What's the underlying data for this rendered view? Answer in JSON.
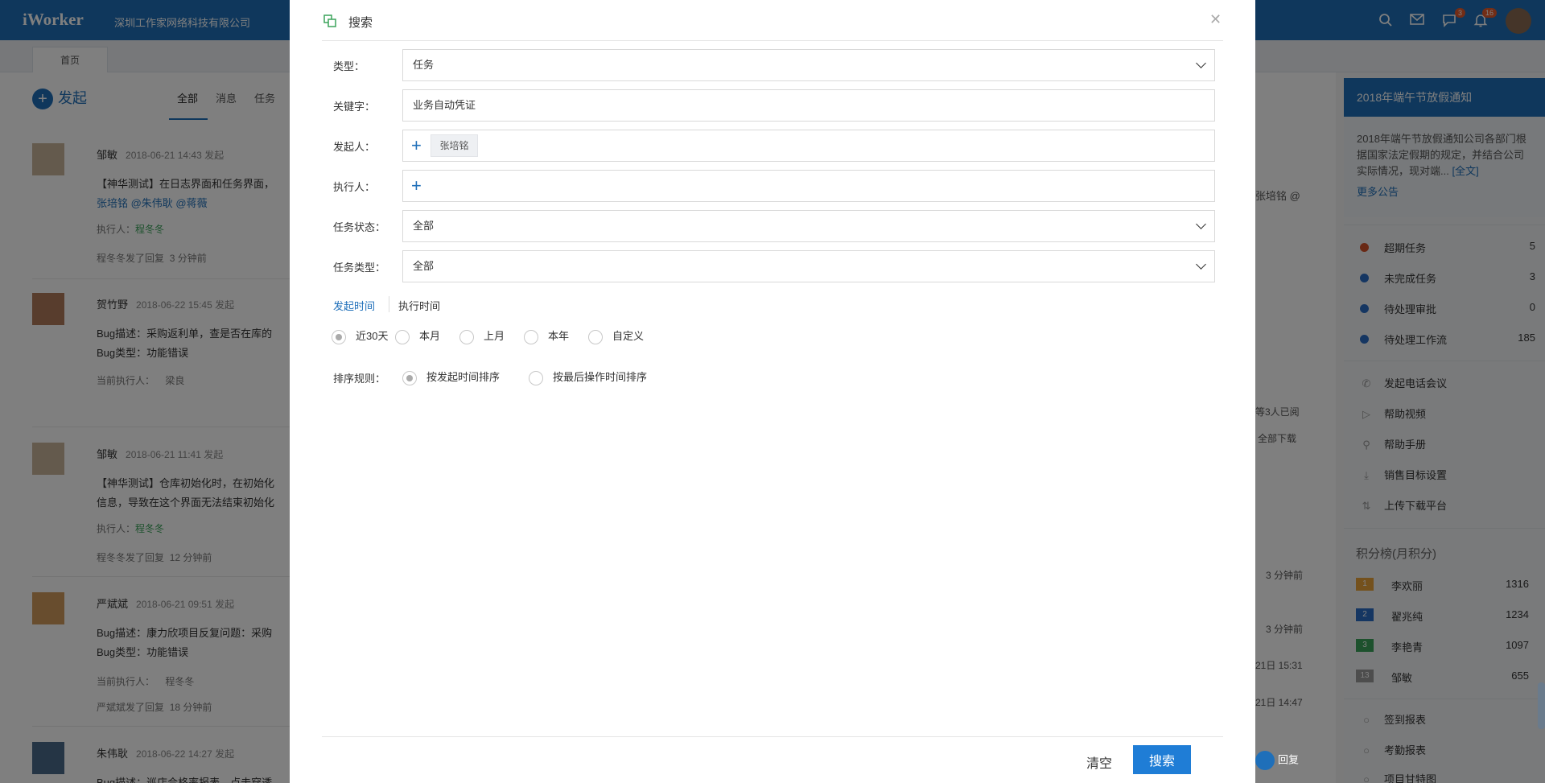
{
  "app": {
    "logo": "iWorker",
    "company": "深圳工作家网络科技有限公司",
    "badges": {
      "messages": "3",
      "notifications": "16"
    }
  },
  "tabs": {
    "home": "首页"
  },
  "feed": {
    "launch_label": "发起",
    "filters": [
      "全部",
      "消息",
      "任务"
    ],
    "items": [
      {
        "name": "邹敏",
        "time": "2018-06-21 14:43 发起",
        "line1": "【神华测试】在日志界面和任务界面，",
        "line2": "张培铭 @朱伟耿 @蒋薇",
        "executor_label": "执行人：",
        "executor": "程冬冬",
        "footer": "程冬冬发了回复",
        "footer_time": "3 分钟前"
      },
      {
        "name": "贺竹野",
        "time": "2018-06-22 15:45 发起",
        "line1": "Bug描述：采购返利单，查是否在库的",
        "line2": "Bug类型：功能错误",
        "executor_label": "当前执行人：",
        "executor": "梁良"
      },
      {
        "name": "邹敏",
        "time": "2018-06-21 11:41 发起",
        "line1": "【神华测试】仓库初始化时，在初始化",
        "line2": "信息，导致在这个界面无法结束初始化",
        "executor_label": "执行人：",
        "executor": "程冬冬",
        "footer": "程冬冬发了回复",
        "footer_time": "12 分钟前"
      },
      {
        "name": "严斌斌",
        "time": "2018-06-21 09:51 发起",
        "line1": "Bug描述：康力欣项目反复问题：采购",
        "line2": "Bug类型：功能错误",
        "executor_label": "当前执行人：",
        "executor": "程冬冬",
        "footer": "严斌斌发了回复",
        "footer_time": "18 分钟前"
      },
      {
        "name": "朱伟耿",
        "time": "2018-06-22 14:27 发起",
        "line1": "Bug描述：巡店合格率报表，点击穿透"
      }
    ],
    "right_texts": {
      "mention": "张培铭 @",
      "read": "等3人已阅",
      "download": "全部下载",
      "t1": "3 分钟前",
      "t2": "3 分钟前",
      "t3": "21日 15:31",
      "t4": "21日 14:47",
      "reply": "回复"
    }
  },
  "sidebar": {
    "notice_title": "2018年端午节放假通知",
    "notice_body": "2018年端午节放假通知公司各部门根据国家法定假期的规定，并结合公司实际情况，现对端...",
    "notice_full": "[全文]",
    "notice_more": "更多公告",
    "stats": [
      {
        "label": "超期任务",
        "value": "5",
        "color": "#d2522a"
      },
      {
        "label": "未完成任务",
        "value": "3",
        "color": "#2b6cc4"
      },
      {
        "label": "待处理审批",
        "value": "0",
        "color": "#2b6cc4"
      },
      {
        "label": "待处理工作流",
        "value": "185",
        "color": "#2b6cc4"
      }
    ],
    "tools": [
      "发起电话会议",
      "帮助视频",
      "帮助手册",
      "销售目标设置",
      "上传下载平台"
    ],
    "rank_title": "积分榜(月积分)",
    "ranks": [
      {
        "rank": "1",
        "name": "李欢丽",
        "score": "1316",
        "color": "#e8a23a"
      },
      {
        "rank": "2",
        "name": "翟兆纯",
        "score": "1234",
        "color": "#2b6cc4"
      },
      {
        "rank": "3",
        "name": "李艳青",
        "score": "1097",
        "color": "#3aa35a"
      },
      {
        "rank": "13",
        "name": "邹敏",
        "score": "655",
        "color": "#9a9a9a"
      }
    ],
    "reports": [
      "签到报表",
      "考勤报表",
      "项目甘特图"
    ]
  },
  "modal": {
    "title": "搜索",
    "fields": {
      "type_label": "类型：",
      "type_value": "任务",
      "keyword_label": "关键字：",
      "keyword_value": "业务自动凭证",
      "initiator_label": "发起人：",
      "initiator_tag": "张培铭",
      "executor_label": "执行人：",
      "status_label": "任务状态：",
      "status_value": "全部",
      "tasktype_label": "任务类型：",
      "tasktype_value": "全部"
    },
    "time_tabs": {
      "initiated": "发起时间",
      "executed": "执行时间"
    },
    "ranges": [
      "近30天",
      "本月",
      "上月",
      "本年",
      "自定义"
    ],
    "sort_label": "排序规则：",
    "sort_options": [
      "按发起时间排序",
      "按最后操作时间排序"
    ],
    "clear_label": "清空",
    "search_label": "搜索",
    "accent": "#1f7dd6"
  }
}
